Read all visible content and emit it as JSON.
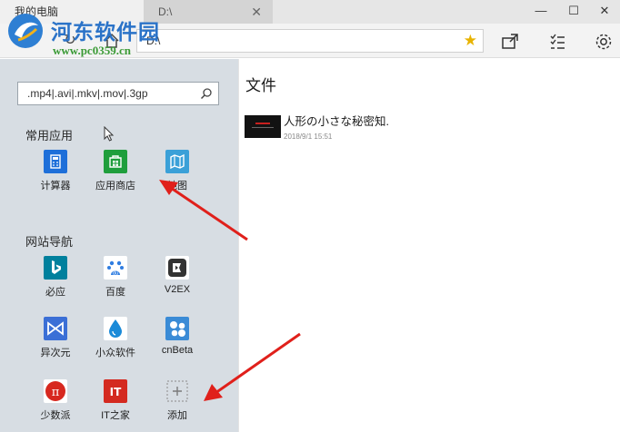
{
  "window": {
    "tabs": [
      {
        "label": "我的电脑"
      },
      {
        "label": "D:\\"
      }
    ],
    "address": "D:\\"
  },
  "watermark": {
    "name": "河东软件园",
    "url": "www.pc0359.cn"
  },
  "search": {
    "value": ".mp4|.avi|.mkv|.mov|.3gp"
  },
  "common_apps": {
    "title": "常用应用",
    "items": [
      {
        "label": "计算器",
        "icon": "calculator-icon",
        "color": "#1e6fd9"
      },
      {
        "label": "应用商店",
        "icon": "store-icon",
        "color": "#1f9e3c"
      },
      {
        "label": "地图",
        "icon": "map-icon",
        "color": "#3aa0d8"
      }
    ]
  },
  "web_nav": {
    "title": "网站导航",
    "items": [
      {
        "label": "必应",
        "icon": "bing-icon",
        "color": "#00809d"
      },
      {
        "label": "百度",
        "icon": "baidu-icon",
        "color": "#2f7de1"
      },
      {
        "label": "V2EX",
        "icon": "v2ex-icon",
        "color": "#333333"
      },
      {
        "label": "异次元",
        "icon": "iplaysoft-icon",
        "color": "#3b6fd6"
      },
      {
        "label": "小众软件",
        "icon": "appinn-icon",
        "color": "#1a8ad8"
      },
      {
        "label": "cnBeta",
        "icon": "cnbeta-icon",
        "color": "#3a8bd6"
      },
      {
        "label": "少数派",
        "icon": "sspai-icon",
        "color": "#d7281f"
      },
      {
        "label": "IT之家",
        "icon": "ithome-icon",
        "color": "#d42a20"
      },
      {
        "label": "添加",
        "icon": "add-icon",
        "color": "#9a9a9a"
      }
    ]
  },
  "files": {
    "title": "文件",
    "items": [
      {
        "name": "人形の小さな秘密知.",
        "date": "2018/9/1 15:51"
      }
    ]
  },
  "colors": {
    "arrow": "#e0201b",
    "panel": "#d7dde3",
    "star": "#e8b300"
  }
}
